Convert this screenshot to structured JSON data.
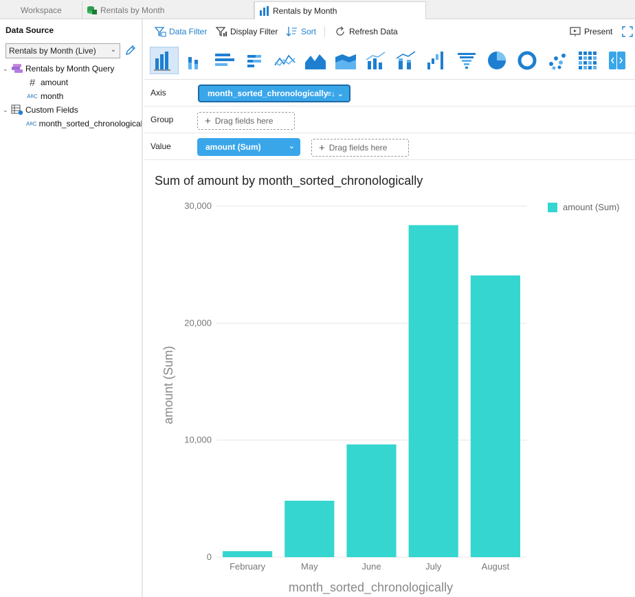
{
  "tabs": [
    {
      "label": "Workspace",
      "icon": "none"
    },
    {
      "label": "Rentals by Month",
      "icon": "data-source-icon"
    },
    {
      "label": "Rentals by Month",
      "icon": "bar-chart-icon"
    }
  ],
  "left_panel": {
    "title": "Data Source",
    "source_select": "Rentals by Month (Live)",
    "tree": [
      {
        "label": "Rentals by Month Query",
        "icon": "query-icon",
        "level": 0,
        "expanded": true
      },
      {
        "label": "amount",
        "icon": "numeric-field-icon",
        "level": 1
      },
      {
        "label": "month",
        "icon": "text-field-icon",
        "level": 1
      },
      {
        "label": "Custom Fields",
        "icon": "custom-fields-icon",
        "level": 0,
        "expanded": true
      },
      {
        "label": "month_sorted_chronologically",
        "icon": "text-field-icon",
        "level": 1
      }
    ]
  },
  "toolbar": {
    "data_filter": "Data Filter",
    "display_filter": "Display Filter",
    "sort": "Sort",
    "refresh": "Refresh Data",
    "present": "Present"
  },
  "fields": {
    "axis_label": "Axis",
    "axis_value": "month_sorted_chronologically",
    "group_label": "Group",
    "value_label": "Value",
    "value_value": "amount (Sum)",
    "drag_placeholder": "Drag fields here"
  },
  "colors": {
    "accent": "#3aa6ea",
    "bar": "#35d6cf"
  },
  "chart_data": {
    "type": "bar",
    "title": "Sum of amount by month_sorted_chronologically",
    "xlabel": "month_sorted_chronologically",
    "ylabel": "amount (Sum)",
    "categories": [
      "February",
      "May",
      "June",
      "July",
      "August"
    ],
    "series": [
      {
        "name": "amount (Sum)",
        "values": [
          514.18,
          4824.43,
          9631.88,
          28373.89,
          24072.13
        ]
      }
    ],
    "ylim": [
      0,
      30000
    ],
    "yticks": [
      0,
      10000,
      20000,
      30000
    ],
    "ytick_labels": [
      "0",
      "10,000",
      "20,000",
      "30,000"
    ],
    "grid": true,
    "legend": "top-right"
  }
}
